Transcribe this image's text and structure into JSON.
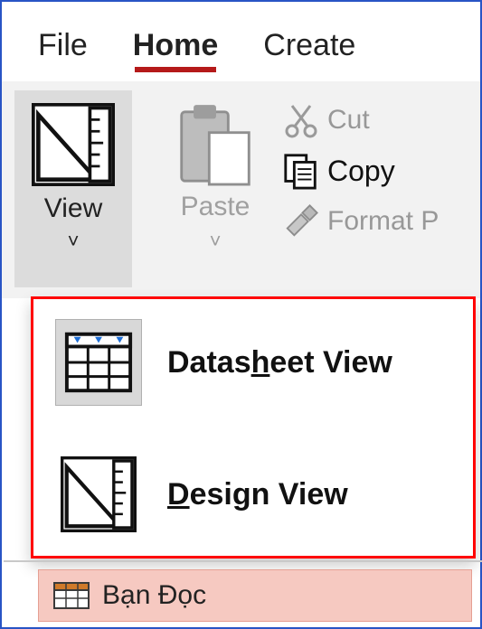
{
  "tabs": {
    "file": "File",
    "home": "Home",
    "create": "Create"
  },
  "ribbon": {
    "view": {
      "label": "View"
    },
    "paste": {
      "label": "Paste"
    },
    "cut": {
      "label": "Cut"
    },
    "copy": {
      "label": "Copy"
    },
    "formatp": {
      "label": "Format P"
    }
  },
  "dropdown": {
    "datasheet": {
      "pre": "Datas",
      "key": "h",
      "post": "eet View"
    },
    "design": {
      "key": "D",
      "post": "esign View"
    }
  },
  "nav": {
    "table_name": "Bạn Đọc"
  }
}
